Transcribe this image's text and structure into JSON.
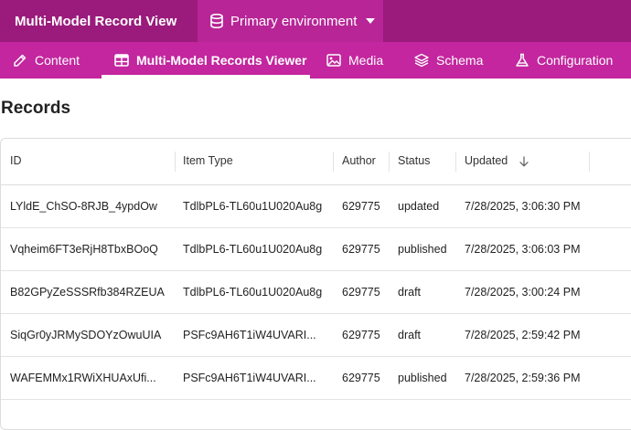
{
  "app": {
    "title": "Multi-Model Record View",
    "environment": "Primary environment"
  },
  "nav": {
    "tabs": [
      {
        "label": "Content"
      },
      {
        "label": "Multi-Model Records Viewer"
      },
      {
        "label": "Media"
      },
      {
        "label": "Schema"
      },
      {
        "label": "Configuration"
      }
    ],
    "active": "Multi-Model Records Viewer"
  },
  "page": {
    "title": "Records"
  },
  "table": {
    "columns": [
      "ID",
      "Item Type",
      "Author",
      "Status",
      "Updated"
    ],
    "sorted_by": "Updated",
    "sort_direction": "descending",
    "rows": [
      [
        "LYldE_ChSO-8RJB_4ypdOw",
        "TdlbPL6-TL60u1U020Au8g",
        "629775",
        "updated",
        "7/28/2025, 3:06:30 PM"
      ],
      [
        "Vqheim6FT3eRjH8TbxBOoQ",
        "TdlbPL6-TL60u1U020Au8g",
        "629775",
        "published",
        "7/28/2025, 3:06:03 PM"
      ],
      [
        "B82GPyZeSSSRfb384RZEUA",
        "TdlbPL6-TL60u1U020Au8g",
        "629775",
        "draft",
        "7/28/2025, 3:00:24 PM"
      ],
      [
        "SiqGr0yJRMySDOYzOwuUIA",
        "PSFc9AH6T1iW4UVARI...",
        "629775",
        "draft",
        "7/28/2025, 2:59:42 PM"
      ],
      [
        "WAFEMMx1RWiXHUAxUfi...",
        "PSFc9AH6T1iW4UVARI...",
        "629775",
        "published",
        "7/28/2025, 2:59:36 PM"
      ]
    ]
  },
  "colors": {
    "topbar": "#9a1b7c",
    "env_selector": "#b72596",
    "navbar": "#c3269e"
  }
}
